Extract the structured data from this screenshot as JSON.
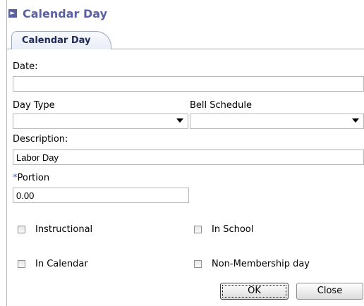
{
  "header": {
    "title": "Calendar Day"
  },
  "tabs": [
    {
      "label": "Calendar Day"
    }
  ],
  "form": {
    "date": {
      "label": "Date:",
      "value": ""
    },
    "day_type": {
      "label": "Day Type",
      "value": ""
    },
    "bell_schedule": {
      "label": "Bell Schedule",
      "value": ""
    },
    "description": {
      "label": "Description:",
      "value": "Labor Day"
    },
    "portion": {
      "required_marker": "*",
      "label": "Portion",
      "value": "0.00"
    },
    "checkboxes": {
      "instructional": {
        "label": "Instructional",
        "checked": false
      },
      "in_school": {
        "label": "In School",
        "checked": false
      },
      "in_calendar": {
        "label": "In Calendar",
        "checked": false
      },
      "non_membership": {
        "label": "Non-Membership day",
        "checked": false
      }
    }
  },
  "buttons": {
    "ok": "OK",
    "close": "Close"
  },
  "colors": {
    "title": "#5b5fa3",
    "tab_text": "#1f2a5a",
    "required": "#3366cc"
  }
}
